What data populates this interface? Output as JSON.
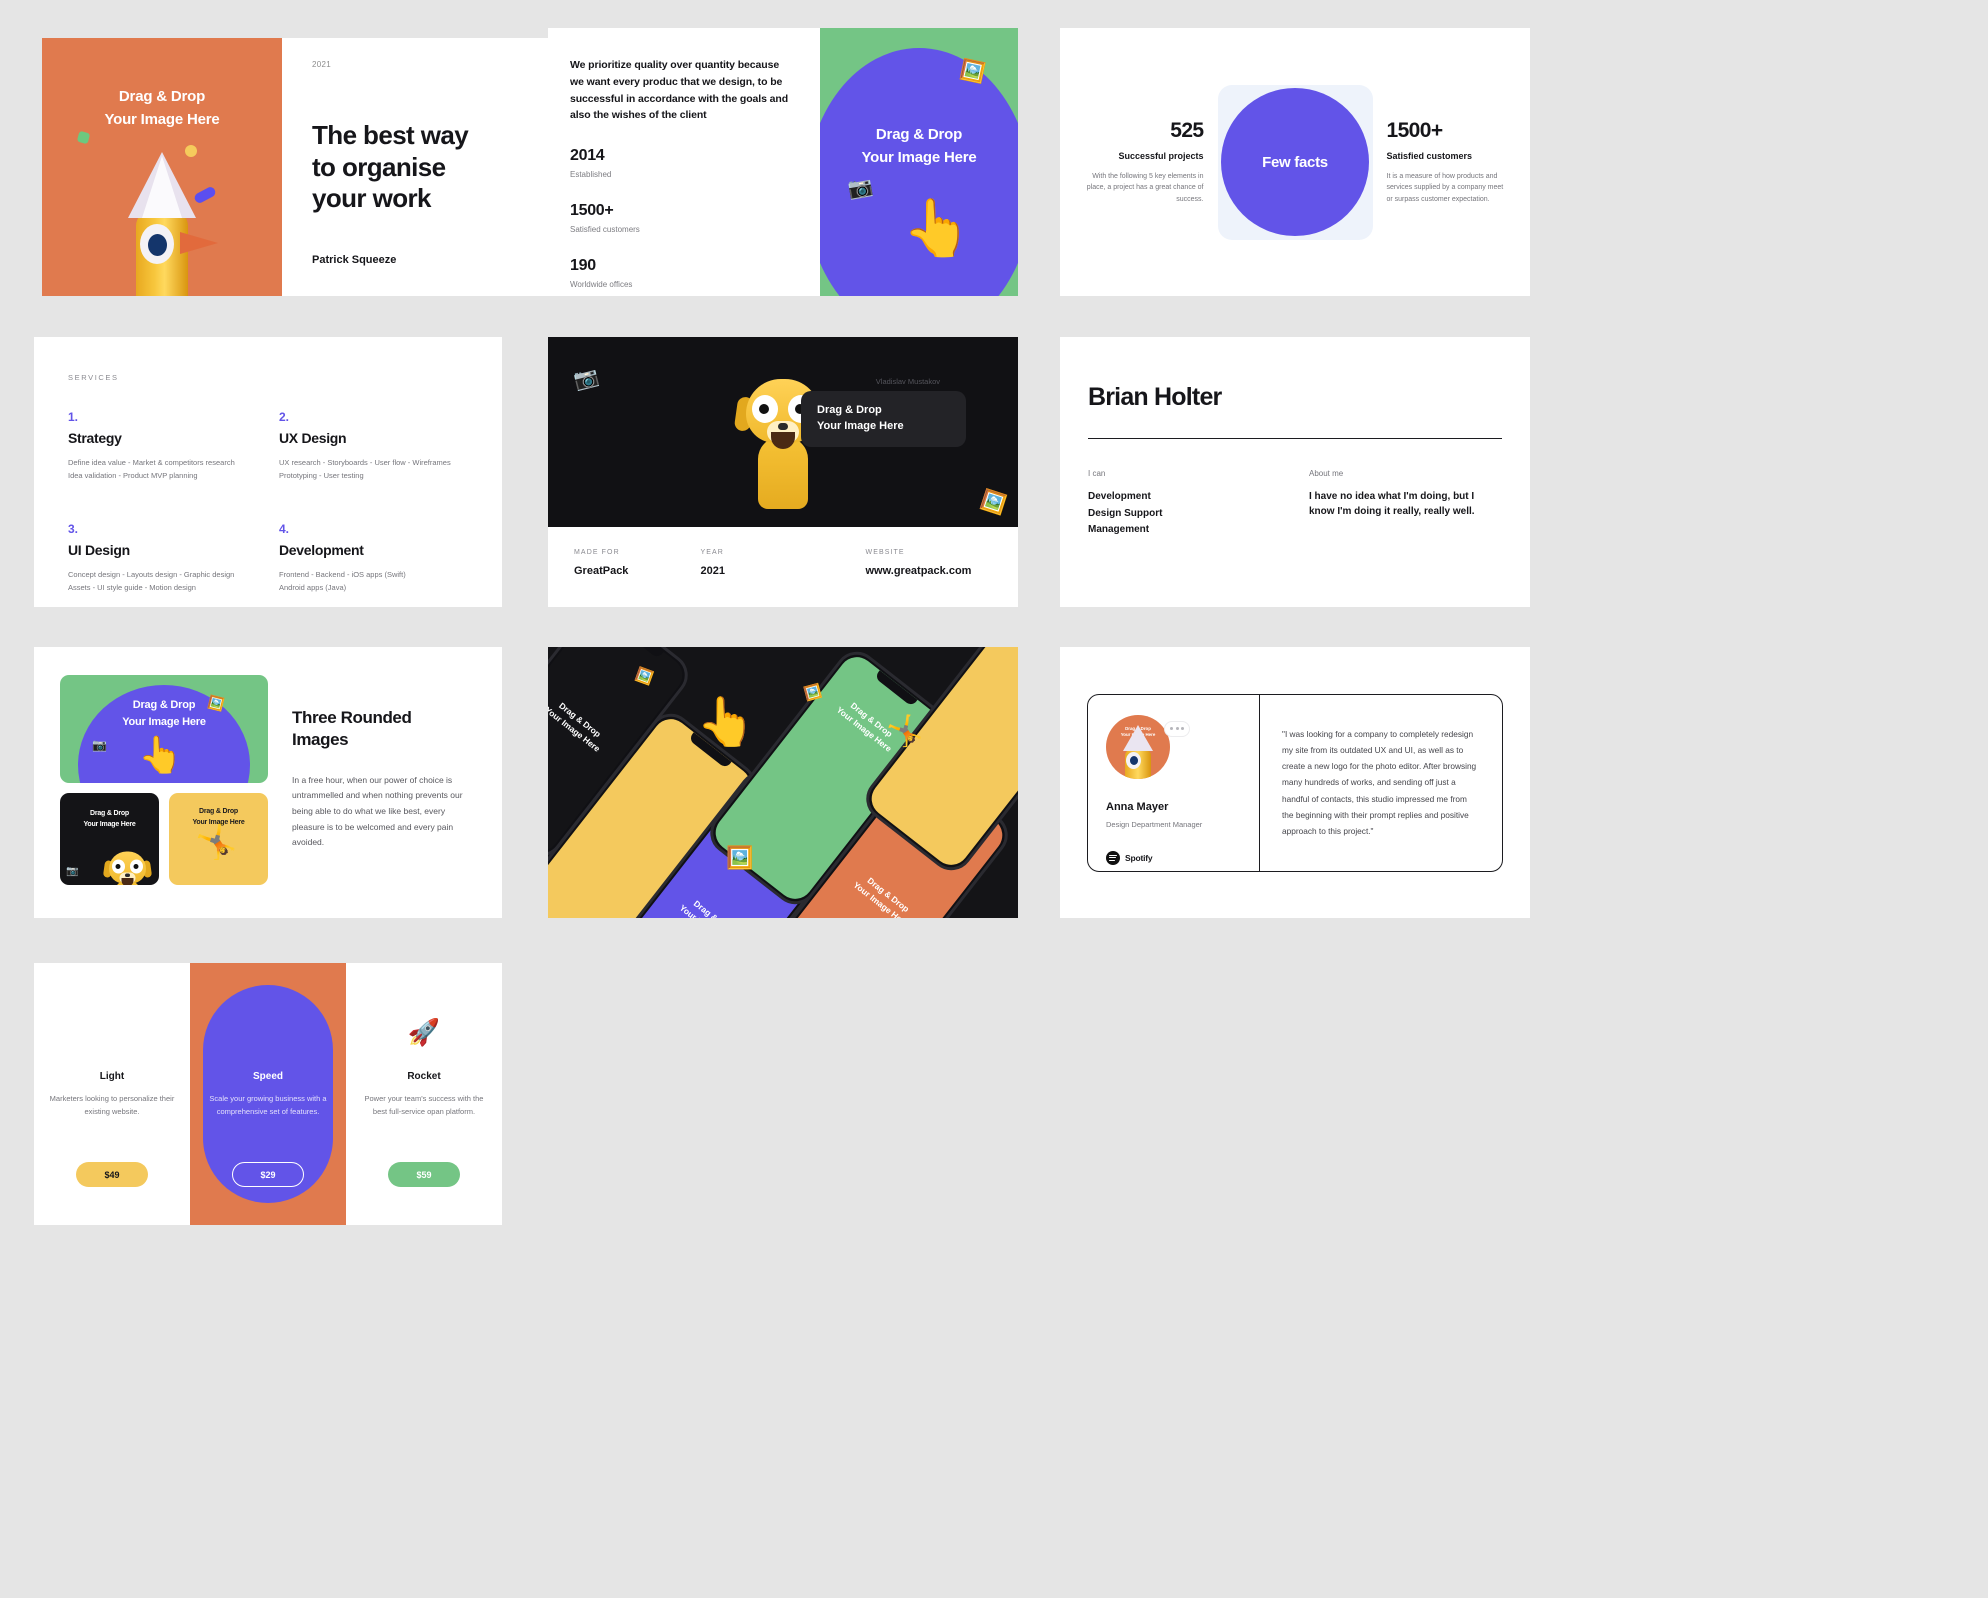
{
  "placeholder": {
    "line1": "Drag & Drop",
    "line2": "Your Image Here"
  },
  "cover": {
    "year": "2021",
    "title_line1": "The best way",
    "title_line2": "to organise",
    "title_line3": "your work",
    "author": "Patrick Squeeze"
  },
  "stats": {
    "paragraph": "We prioritize quality over quantity because we want every produc that we design, to be successful in accordance with the goals and also the wishes of the client",
    "items": [
      {
        "number": "2014",
        "label": "Established"
      },
      {
        "number": "1500+",
        "label": "Satisfied customers"
      },
      {
        "number": "190",
        "label": "Worldwide offices"
      }
    ]
  },
  "facts": {
    "center_label": "Few facts",
    "left": {
      "number": "525",
      "subtitle": "Successful projects",
      "text": "With the following 5 key elements in place, a project has a great chance of success."
    },
    "right": {
      "number": "1500+",
      "subtitle": "Satisfied customers",
      "text": "It is a measure of how products and services supplied by a company meet or surpass customer expectation."
    }
  },
  "services": {
    "kicker": "SERVICES",
    "items": [
      {
        "num": "1.",
        "title": "Strategy",
        "desc_line1": "Define idea value - Market & competitors research",
        "desc_line2": "Idea validation - Product MVP planning"
      },
      {
        "num": "2.",
        "title": "UX Design",
        "desc_line1": "UX research - Storyboards - User flow - Wireframes",
        "desc_line2": "Prototyping - User testing"
      },
      {
        "num": "3.",
        "title": "UI Design",
        "desc_line1": "Concept design - Layouts design - Graphic design",
        "desc_line2": "Assets - UI style guide - Motion design"
      },
      {
        "num": "4.",
        "title": "Development",
        "desc_line1": "Frontend - Backend - iOS apps (Swift)",
        "desc_line2": "Android apps (Java)"
      }
    ]
  },
  "project": {
    "image_caption": "Vladislav Mustakov",
    "meta": [
      {
        "key": "MADE FOR",
        "value": "GreatPack"
      },
      {
        "key": "YEAR",
        "value": "2021"
      },
      {
        "key": "WEBSITE",
        "value": "www.greatpack.com"
      }
    ]
  },
  "bio": {
    "name": "Brian Holter",
    "left_label": "I can",
    "skills": "Development\nDesign Support\nManagement",
    "right_label": "About me",
    "about": "I have no idea what I'm doing, but I know I'm doing it really, really well."
  },
  "three_images": {
    "title_line1": "Three Rounded",
    "title_line2": "Images",
    "paragraph": "In a free hour, when our power of choice is untrammelled and when nothing prevents our being able to do what we like best, every pleasure is to be welcomed and every pain avoided."
  },
  "quote": {
    "name": "Anna Mayer",
    "role": "Design Department Manager",
    "brand": "Spotify",
    "text": "\"I was looking for a company to completely redesign my site from its outdated UX and UI, as well as to create a new logo for the photo editor. After browsing many hundreds of works, and sending off just a handful of contacts, this studio impressed me from the beginning with their prompt replies and positive approach to this project.\""
  },
  "pricing": {
    "plans": [
      {
        "icon": "",
        "name": "Light",
        "desc": "Marketers looking to personalize their existing website.",
        "price": "$49",
        "button_style": "yellow"
      },
      {
        "icon": "",
        "name": "Speed",
        "desc": "Scale your growing business with a comprehensive set of features.",
        "price": "$29",
        "button_style": "outline"
      },
      {
        "icon": "🚀",
        "name": "Rocket",
        "desc": "Power your team's success with the best full-service opan platform.",
        "price": "$59",
        "button_style": "green"
      }
    ]
  },
  "colors": {
    "page_bg": "#e5e5e5",
    "purple": "#6254e8",
    "orange": "#e07a4e",
    "green": "#74c585",
    "yellow": "#f4c95d",
    "dark": "#141417"
  }
}
